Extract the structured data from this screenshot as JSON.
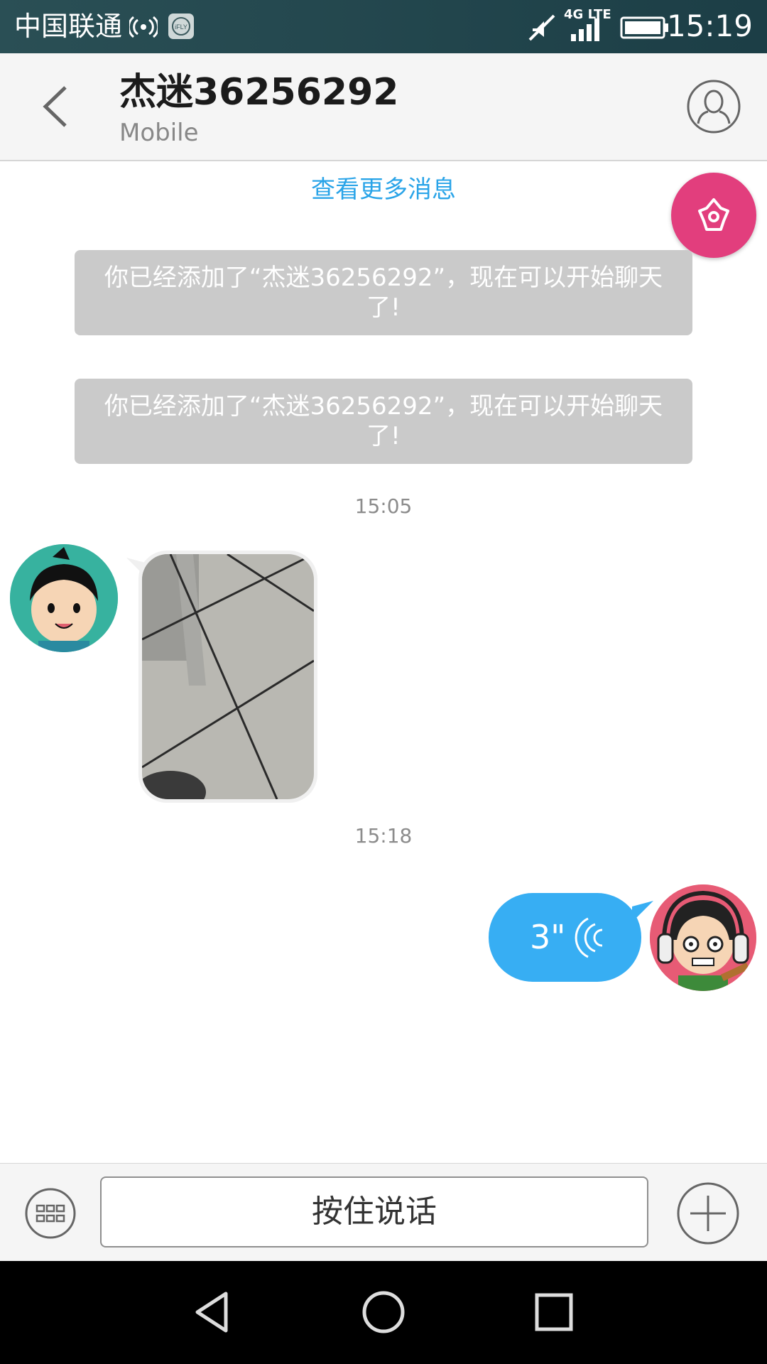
{
  "status_bar": {
    "carrier": "中国联通",
    "network": "4G LTE",
    "time": "15:19",
    "icons": [
      "hotspot-icon",
      "ifly-icon",
      "mute-icon",
      "signal-icon",
      "battery-icon"
    ]
  },
  "header": {
    "title": "杰迷36256292",
    "subtitle": "Mobile",
    "icons": [
      "back-arrow-icon",
      "profile-icon"
    ]
  },
  "chat": {
    "load_more": "查看更多消息",
    "system_messages": [
      "你已经添加了“杰迷36256292”，现在可以开始聊天了!",
      "你已经添加了“杰迷36256292”，现在可以开始聊天了!"
    ],
    "timestamps": [
      "15:05",
      "15:18"
    ],
    "voice_message": {
      "duration": "3\""
    }
  },
  "input_bar": {
    "hold_to_talk": "按住说话",
    "icons": [
      "keyboard-icon",
      "plus-icon"
    ]
  },
  "nav_bar": {
    "icons": [
      "back-triangle-icon",
      "home-circle-icon",
      "recent-square-icon"
    ]
  },
  "colors": {
    "accent_blue": "#37aef3",
    "link_blue": "#2aa4e8",
    "float_pink": "#e23e7d",
    "system_grey": "#cacaca"
  }
}
